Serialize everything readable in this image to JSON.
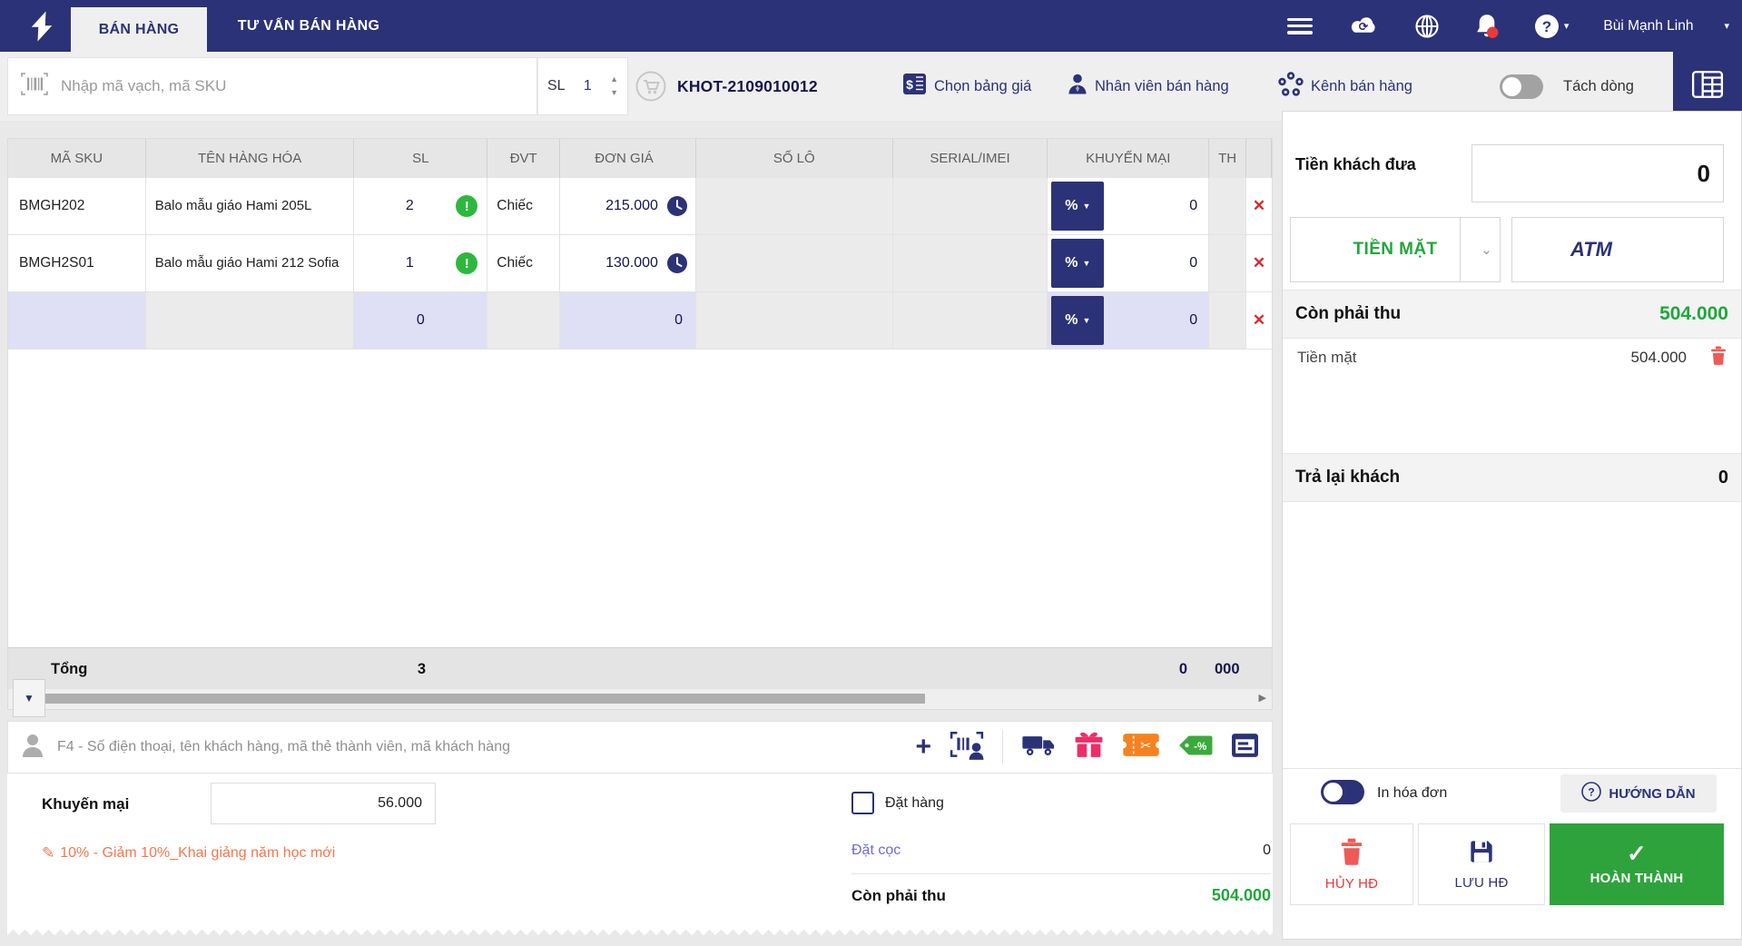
{
  "navbar": {
    "tabs": [
      {
        "label": "BÁN HÀNG"
      },
      {
        "label": "TƯ VẤN BÁN HÀNG"
      }
    ],
    "user": "Bùi Mạnh Linh"
  },
  "toolbar": {
    "barcode_placeholder": "Nhập mã vạch, mã SKU",
    "qty_label": "SL",
    "qty_value": "1",
    "order_code": "KHOT-2109010012",
    "price_list": "Chọn bảng giá",
    "staff": "Nhân viên bán hàng",
    "channel": "Kênh bán hàng",
    "split_line": "Tách dòng"
  },
  "table": {
    "headers": {
      "sku": "MÃ SKU",
      "name": "TÊN HÀNG HÓA",
      "qty": "SL",
      "unit": "ĐVT",
      "price": "ĐƠN GIÁ",
      "lot": "SỐ LÔ",
      "serial": "SERIAL/IMEI",
      "promo": "KHUYẾN MẠI",
      "amount": "TH"
    },
    "rows": [
      {
        "sku": "BMGH202",
        "name": "Balo mẫu giáo Hami 205L",
        "qty": "2",
        "unit": "Chiếc",
        "price": "215.000",
        "promo_type": "%",
        "promo_value": "0"
      },
      {
        "sku": "BMGH2S01",
        "name": "Balo mẫu giáo Hami 212 Sofia",
        "qty": "1",
        "unit": "Chiếc",
        "price": "130.000",
        "promo_type": "%",
        "promo_value": "0"
      },
      {
        "sku": "",
        "name": "",
        "qty": "0",
        "unit": "",
        "price": "0",
        "promo_type": "%",
        "promo_value": "0"
      }
    ],
    "footer": {
      "label": "Tổng",
      "qty": "3",
      "promo": "0",
      "amount": "000"
    }
  },
  "customer": {
    "placeholder": "F4 - Số điện thoại, tên khách hàng, mã thẻ thành viên, mã khách hàng"
  },
  "summary": {
    "promo_label": "Khuyến mại",
    "promo_value": "56.000",
    "promo_note": "10% - Giảm 10%_Khai giảng năm học mới",
    "order_label": "Đặt hàng",
    "deposit_label": "Đặt cọc",
    "deposit_value": "0",
    "due_label": "Còn phải thu",
    "due_value": "504.000"
  },
  "payment": {
    "cash_given_label": "Tiền khách đưa",
    "cash_given_value": "0",
    "cash_btn": "TIỀN MẶT",
    "atm_btn": "ATM",
    "due_label": "Còn phải thu",
    "due_value": "504.000",
    "method_label": "Tiền mặt",
    "method_value": "504.000",
    "change_label": "Trả lại khách",
    "change_value": "0",
    "print_label": "In hóa đơn",
    "guide": "HƯỚNG DẪN",
    "cancel": "HỦY HĐ",
    "save": "LƯU HĐ",
    "complete": "HOÀN THÀNH"
  },
  "colors": {
    "navy": "#2C3277",
    "green": "#1FA73B",
    "red": "#E8393D",
    "orange_note": "#F4764E",
    "gift_pink": "#EE2D68",
    "voucher_orange": "#F5821F",
    "tag_green": "#3BAA3B",
    "done_green": "#2EA33C"
  }
}
